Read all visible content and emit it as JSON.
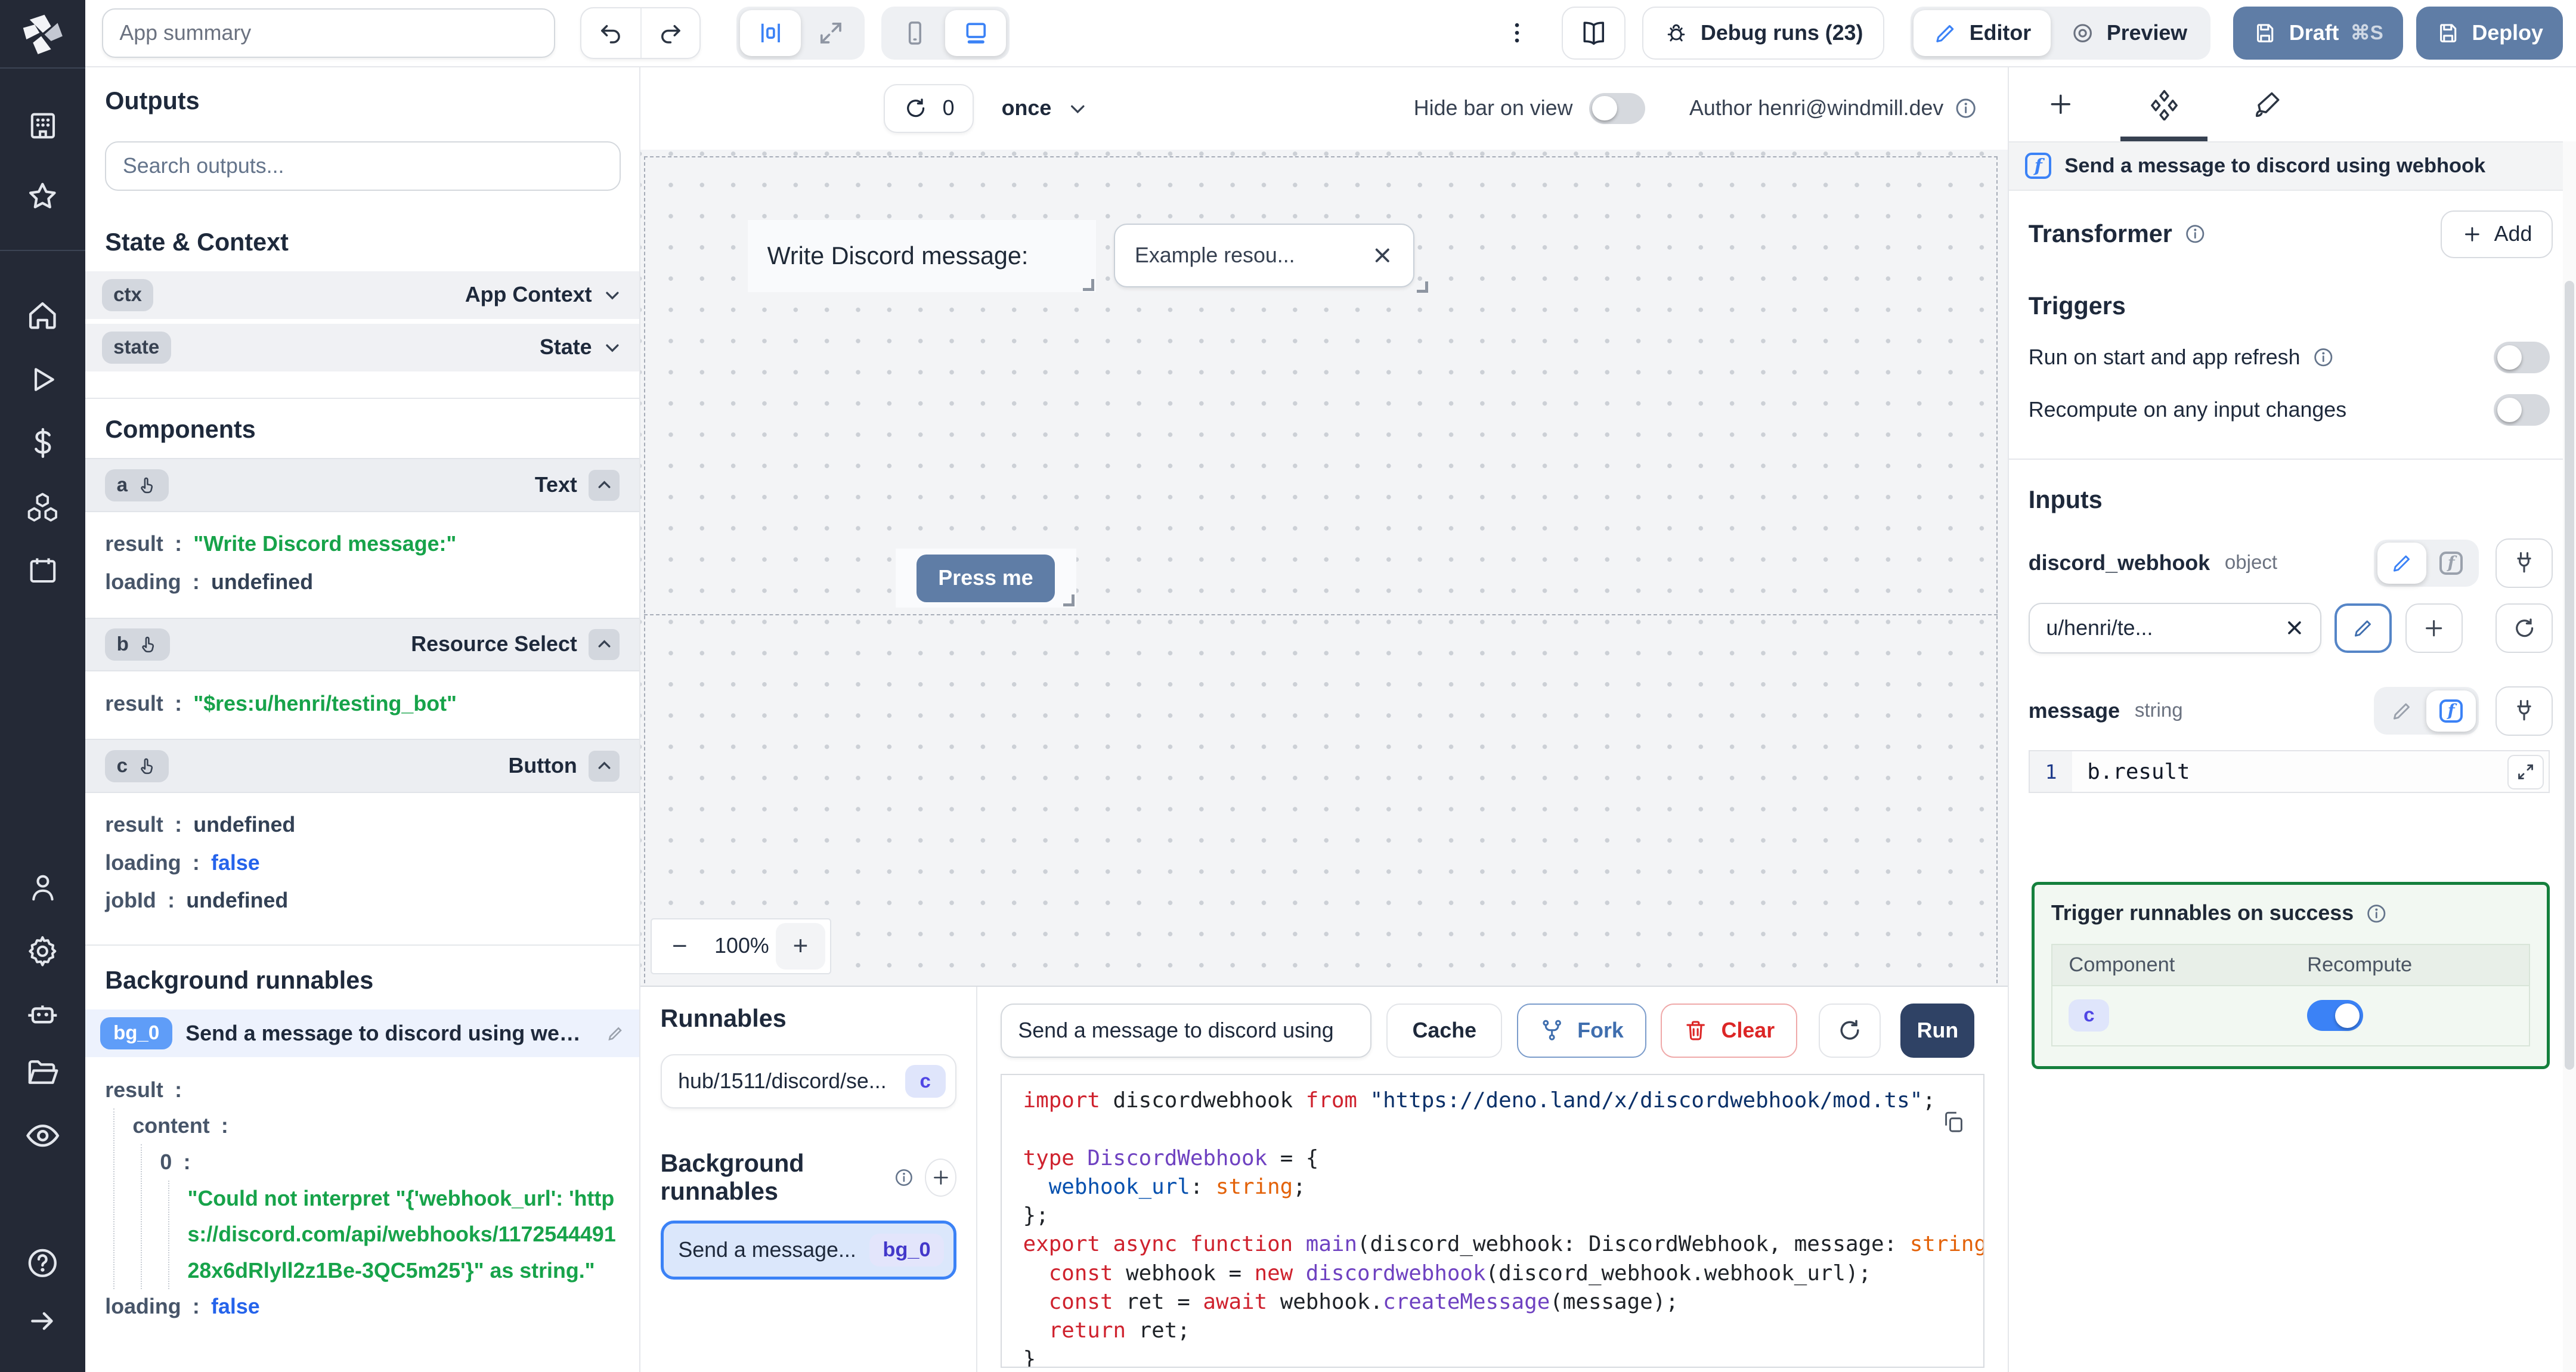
{
  "colors": {
    "accent_blue": "#3b82f6",
    "slate_button": "#5f7da6",
    "run_button": "#2f4265",
    "string_green": "#17a34a",
    "bool_blue": "#2563eb",
    "success_border": "#15803d",
    "indigo_badge_text": "#4f46e5",
    "bg0_sidebar_badge": "#5f9df8"
  },
  "topbar": {
    "app_summary_placeholder": "App summary",
    "debug_runs_label": "Debug runs (23)",
    "editor_label": "Editor",
    "preview_label": "Preview",
    "draft_label": "Draft",
    "draft_shortcut": "⌘S",
    "deploy_label": "Deploy"
  },
  "outputs": {
    "title": "Outputs",
    "search_placeholder": "Search outputs...",
    "state_context_title": "State & Context",
    "context_rows": [
      {
        "chip": "ctx",
        "label": "App Context"
      },
      {
        "chip": "state",
        "label": "State"
      }
    ],
    "components_title": "Components",
    "components": [
      {
        "chip": "a",
        "type": "Text",
        "kv": [
          {
            "key": "result",
            "value": "\"Write Discord message:\"",
            "vtype": "string"
          },
          {
            "key": "loading",
            "value": "undefined",
            "vtype": "plain"
          }
        ]
      },
      {
        "chip": "b",
        "type": "Resource Select",
        "kv": [
          {
            "key": "result",
            "value": "\"$res:u/henri/testing_bot\"",
            "vtype": "string"
          }
        ]
      },
      {
        "chip": "c",
        "type": "Button",
        "kv": [
          {
            "key": "result",
            "value": "undefined",
            "vtype": "plain"
          },
          {
            "key": "loading",
            "value": "false",
            "vtype": "bool"
          },
          {
            "key": "jobId",
            "value": "undefined",
            "vtype": "plain"
          }
        ]
      }
    ],
    "bg_title": "Background runnables",
    "bg_chip": "bg_0",
    "bg_label": "Send a message to discord using webhook",
    "tree": {
      "root_key": "result",
      "child_key": "content",
      "index_key": "0",
      "string_value": "\"Could not interpret \"{'webhook_url': 'https://discord.com/api/webhooks/117254449128x6dRlyll2z1Be-3QC5m25'}\" as string.\"",
      "loading_key": "loading",
      "loading_value": "false"
    }
  },
  "canvas": {
    "toolbar": {
      "refresh_count": "0",
      "schedule": "once",
      "hide_bar_label": "Hide bar on view",
      "hide_bar_on": false,
      "author_label": "Author henri@windmill.dev"
    },
    "text_component": "Write Discord message:",
    "select_value": "Example resou...",
    "button_label": "Press me",
    "zoom_out": "−",
    "zoom_value": "100%",
    "zoom_in": "+"
  },
  "runnables": {
    "title": "Runnables",
    "item_label": "hub/1511/discord/se...",
    "item_badge": "c",
    "bg_title": "Background runnables",
    "bg_item_label": "Send a message...",
    "bg_item_badge": "bg_0"
  },
  "code_panel": {
    "script_name": "Send a message to discord using",
    "cache_label": "Cache",
    "fork_label": "Fork",
    "clear_label": "Clear",
    "run_label": "Run",
    "code_lines": [
      [
        [
          "kw",
          "import"
        ],
        [
          "def",
          " discordwebhook "
        ],
        [
          "kw",
          "from"
        ],
        [
          "str",
          " \"https://deno.land/x/discordwebhook/mod.ts\""
        ],
        [
          "def",
          ";"
        ]
      ],
      [],
      [
        [
          "kw",
          "type"
        ],
        [
          "type",
          " DiscordWebhook"
        ],
        [
          "def",
          " = {"
        ]
      ],
      [
        [
          "prop",
          "  webhook_url"
        ],
        [
          "def",
          ": "
        ],
        [
          "tstr",
          "string"
        ],
        [
          "def",
          ";"
        ]
      ],
      [
        [
          "def",
          "};"
        ]
      ],
      [
        [
          "kw",
          "export"
        ],
        [
          "kw",
          " async"
        ],
        [
          "kw",
          " function"
        ],
        [
          "fn",
          " main"
        ],
        [
          "def",
          "(discord_webhook: DiscordWebhook, message: "
        ],
        [
          "tstr",
          "string"
        ],
        [
          "def",
          ") {"
        ]
      ],
      [
        [
          "kw",
          "  const"
        ],
        [
          "def",
          " webhook = "
        ],
        [
          "kw",
          "new"
        ],
        [
          "type",
          " discordwebhook"
        ],
        [
          "def",
          "(discord_webhook.webhook_url);"
        ]
      ],
      [
        [
          "kw",
          "  const"
        ],
        [
          "def",
          " ret = "
        ],
        [
          "kw",
          "await"
        ],
        [
          "def",
          " webhook."
        ],
        [
          "fn",
          "createMessage"
        ],
        [
          "def",
          "(message);"
        ]
      ],
      [
        [
          "kw",
          "  return"
        ],
        [
          "def",
          " ret;"
        ]
      ],
      [
        [
          "def",
          "}"
        ]
      ]
    ]
  },
  "right_panel": {
    "header": "Send a message to discord using webhook",
    "transformer_label": "Transformer",
    "add_label": "Add",
    "triggers_title": "Triggers",
    "trigger_rows": [
      {
        "label": "Run on start and app refresh",
        "on": false
      },
      {
        "label": "Recompute on any input changes",
        "on": false
      }
    ],
    "inputs_title": "Inputs",
    "fields": [
      {
        "name": "discord_webhook",
        "type": "object",
        "value": "u/henri/te..."
      },
      {
        "name": "message",
        "type": "string",
        "editor_line": "1",
        "editor_value": "b.result"
      }
    ],
    "success_box": {
      "title": "Trigger runnables on success",
      "columns": [
        "Component",
        "Recompute"
      ],
      "rows": [
        {
          "component": "c",
          "recompute": true
        }
      ]
    }
  }
}
